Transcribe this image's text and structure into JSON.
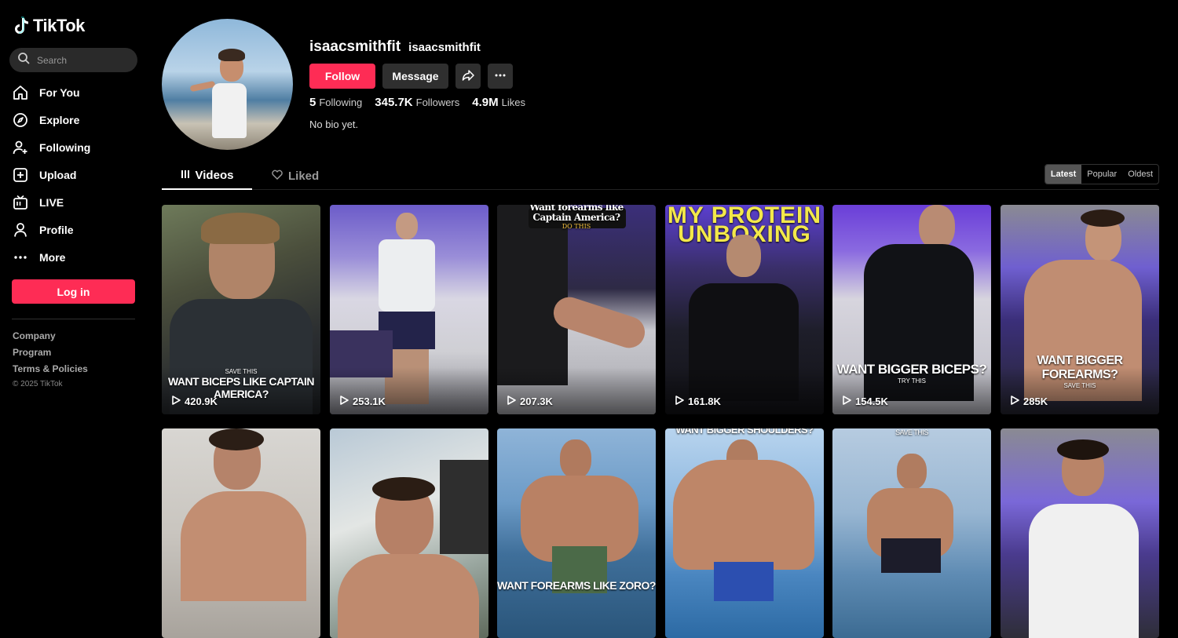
{
  "app": {
    "logo_text": "TikTok"
  },
  "search": {
    "placeholder": "Search"
  },
  "nav": {
    "items": [
      {
        "label": "For You",
        "icon": "home-icon"
      },
      {
        "label": "Explore",
        "icon": "compass-icon"
      },
      {
        "label": "Following",
        "icon": "user-plus-icon"
      },
      {
        "label": "Upload",
        "icon": "plus-square-icon"
      },
      {
        "label": "LIVE",
        "icon": "live-tv-icon"
      },
      {
        "label": "Profile",
        "icon": "person-icon"
      },
      {
        "label": "More",
        "icon": "more-dots-icon"
      }
    ]
  },
  "login_label": "Log in",
  "footer": {
    "links": [
      "Company",
      "Program",
      "Terms & Policies"
    ],
    "copyright": "© 2025 TikTok"
  },
  "profile": {
    "handle": "isaacsmithfit",
    "nickname": "isaacsmithfit",
    "follow_label": "Follow",
    "message_label": "Message",
    "stats": {
      "following_count": "5",
      "following_label": "Following",
      "followers_count": "345.7K",
      "followers_label": "Followers",
      "likes_count": "4.9M",
      "likes_label": "Likes"
    },
    "bio": "No bio yet."
  },
  "tabs": {
    "videos": "Videos",
    "liked": "Liked"
  },
  "sort": {
    "latest": "Latest",
    "popular": "Popular",
    "oldest": "Oldest"
  },
  "videos": [
    {
      "views": "420.9K",
      "caption_top": "SAVE THIS",
      "caption": "WANT BICEPS LIKE CAPTAIN AMERICA?"
    },
    {
      "views": "253.1K",
      "caption_top": "",
      "caption": ""
    },
    {
      "views": "207.3K",
      "caption_top": "Want forearms like Captain America?",
      "caption": "DO THIS"
    },
    {
      "views": "161.8K",
      "caption_top": "MY PROTEIN UNBOXING",
      "caption": ""
    },
    {
      "views": "154.5K",
      "caption_top": "",
      "caption": "WANT BIGGER BICEPS?",
      "caption_sub": "TRY THIS"
    },
    {
      "views": "285K",
      "caption_top": "",
      "caption": "WANT BIGGER FOREARMS?",
      "caption_sub": "SAVE THIS"
    },
    {
      "views": "",
      "caption_top": "",
      "caption": ""
    },
    {
      "views": "",
      "caption_top": "",
      "caption": ""
    },
    {
      "views": "",
      "caption_top": "",
      "caption": "WANT FOREARMS LIKE ZORO?"
    },
    {
      "views": "",
      "caption_top": "WANT BIGGER SHOULDERS?",
      "caption": ""
    },
    {
      "views": "",
      "caption_top": "SAVE THIS",
      "caption": ""
    },
    {
      "views": "",
      "caption_top": "",
      "caption": ""
    }
  ],
  "colors": {
    "accent": "#fe2c55",
    "background": "#000000",
    "secondary_button": "#2f2f2f"
  }
}
